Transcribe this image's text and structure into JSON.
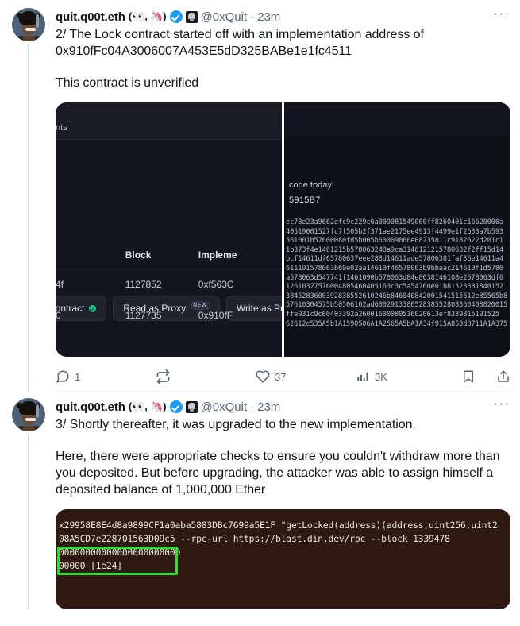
{
  "author": {
    "display_name": "quit.q00t.eth",
    "name_suffix": "(👀, 🦄)",
    "handle": "@0xQuit",
    "verified_badge": "verified-blue-check",
    "secondary_badge": "dark-square-badge",
    "avatar_alt": "cartoon-avatar"
  },
  "tweets": [
    {
      "timestamp": "23m",
      "separator": "·",
      "text": "2/ The Lock contract started off with an implementation address of 0x910fFc04A3006007A453E5dD325BABe1e1fc4511",
      "text2": "This contract is unverified",
      "more_label": "···",
      "media": {
        "kind": "block-explorer-screenshot",
        "left_panel": {
          "tab_label": "nts",
          "buttons": [
            {
              "label": "Contract",
              "status_icon": "green-check-icon",
              "tag": ""
            },
            {
              "label": "Read as Proxy",
              "status_icon": "",
              "tag": "NEW"
            },
            {
              "label": "Write as Prox",
              "status_icon": "",
              "tag": ""
            }
          ],
          "table": {
            "columns": [
              "",
              "Block",
              "Impleme"
            ],
            "rows": [
              [
                "4f",
                "1127852",
                "0xf563C"
              ],
              [
                "0",
                "1127735",
                "0x910fF"
              ]
            ]
          }
        },
        "right_panel": {
          "note": "code today!",
          "note2": "5915B7",
          "hex_lines": [
            "ec73e23a9662efc9c229c6a009081549060ff8260401c16620000a",
            "40519081527fc7f505b2f371ae2175ee4913f4499e1f2633a7b593",
            "561001b57600080fd5b005b60009060e08235811c9182622d201c1",
            "1b373f4e1461215b578063248a9ca3146121215780632f2ff15d14",
            "bcf14611df65780637eee288d14611ade57806381faf36e14611a4",
            "611191578063b69e02aa14610f46578063b9bbaac214610f1d5780",
            "a578063d547741f1461090b578063d84e8038146108e2578063df6",
            "12610327576004805460405163c3c5a54760e01b81523381840152",
            "3845283600392838552610246b846040842001541515612e85565b8",
            "57610304575b50506102ad600291338652838552808360408820015",
            "ffe931c9c60403392a26001600080516020613ef8339815191525",
            "62612c535A5b1A1590506A1A2565A5bA1A34f915A853d8711A1A375"
          ],
          "side_chars": [
            "e",
            "c",
            "f"
          ]
        }
      },
      "actions": {
        "reply_count": "1",
        "retweet_count": "",
        "like_count": "37",
        "view_count": "3K",
        "reply_icon": "reply-icon",
        "retweet_icon": "retweet-icon",
        "like_icon": "heart-icon",
        "views_icon": "analytics-icon",
        "bookmark_icon": "bookmark-icon",
        "share_icon": "share-icon"
      }
    },
    {
      "timestamp": "23m",
      "separator": "·",
      "text": "3/ Shortly thereafter, it was upgraded to the new implementation.",
      "text2": "Here, there were appropriate checks to ensure you couldn't withdraw more than you deposited. But before upgrading, the attacker was able to assign himself a deposited balance of 1,000,000 Ether",
      "more_label": "···",
      "media": {
        "kind": "terminal-screenshot",
        "lines": [
          "x29958E8E4d8a9899CF1a0aba5883DBc7699a5E1F \"getLocked(address)(address,uint256,uint2",
          "08A5CD7e228701563D09c5 --rpc-url https://blast.din.dev/rpc --block 1339478",
          "00000000000000000000000",
          "00000 [1e24]"
        ],
        "highlight_value": "[1e24]",
        "highlight_color": "#2ae02a",
        "background_color": "#2e1a10"
      }
    }
  ],
  "colors": {
    "accent": "#1d9bf0",
    "text": "#0f1419",
    "muted": "#536471",
    "thread_line": "#cfd9de",
    "border": "#eff3f4"
  }
}
